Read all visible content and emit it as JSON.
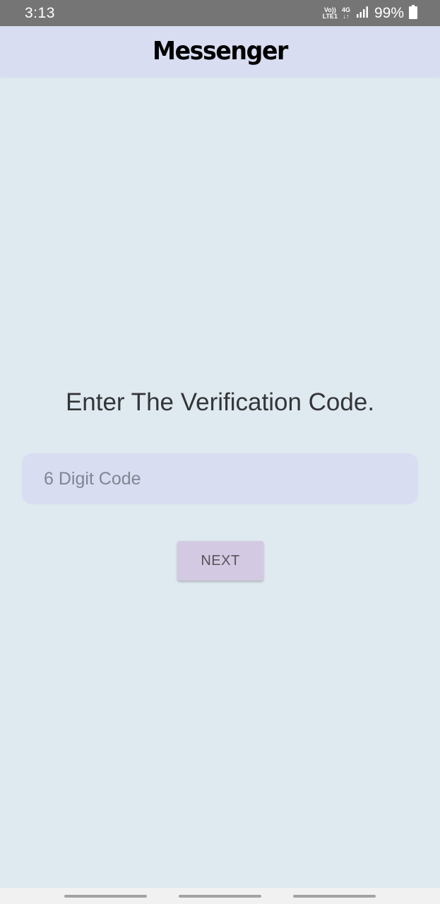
{
  "status_bar": {
    "time": "3:13",
    "volte_top": "Vo))",
    "volte_bottom": "LTE1",
    "network_type": "4G",
    "network_arrows": "↓↑",
    "battery_percent": "99%",
    "icons": [
      "signal-icon",
      "battery-icon"
    ]
  },
  "app_bar": {
    "title": "Messenger"
  },
  "main": {
    "heading": "Enter The Verification Code.",
    "code_input": {
      "value": "",
      "placeholder": "6 Digit Code"
    },
    "next_button": "NEXT"
  },
  "nav_bar": {
    "handles": [
      "recent-apps",
      "home",
      "back"
    ]
  },
  "colors": {
    "background": "#dfe9f0",
    "app_bar": "#d8ddf1",
    "input_background": "#d8ddf1",
    "button_background": "#d4c9e2",
    "status_bar": "#757575"
  }
}
